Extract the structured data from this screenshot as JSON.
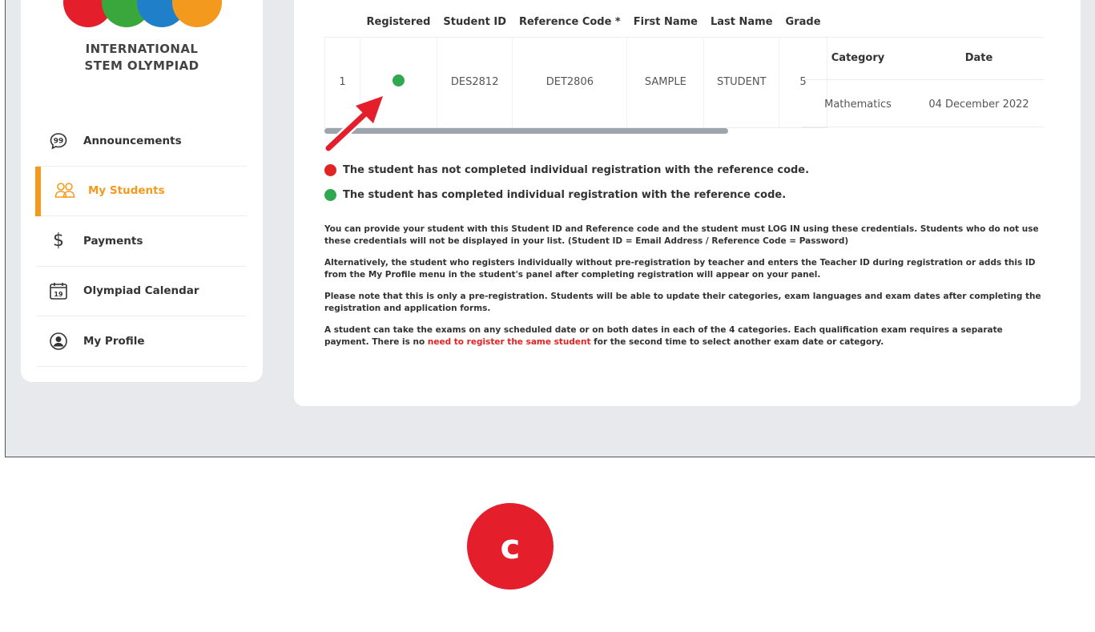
{
  "sidebar": {
    "brand_line1": "INTERNATIONAL",
    "brand_line2": "STEM OLYMPIAD",
    "logo_colors": [
      "#e41e2b",
      "#3aa73c",
      "#1f7fc8",
      "#f39a1e"
    ],
    "items": [
      {
        "label": "Announcements",
        "icon": "speech-bubble-icon",
        "active": false
      },
      {
        "label": "My Students",
        "icon": "students-icon",
        "active": true
      },
      {
        "label": "Payments",
        "icon": "dollar-icon",
        "active": false
      },
      {
        "label": "Olympiad Calendar",
        "icon": "calendar-icon",
        "active": false
      },
      {
        "label": "My Profile",
        "icon": "profile-icon",
        "active": false
      }
    ],
    "calendar_day": "19",
    "active_color": "#f39a1e"
  },
  "table": {
    "headers": [
      "Registered",
      "Student ID",
      "Reference Code *",
      "First Name",
      "Last Name",
      "Grade"
    ],
    "row": {
      "index": "1",
      "registered_status": "completed",
      "student_id": "DES2812",
      "reference_code": "DET2806",
      "first_name": "SAMPLE",
      "last_name": "STUDENT",
      "grade": "5"
    },
    "sub_headers": [
      "Category",
      "Date"
    ],
    "sub_row": {
      "category": "Mathematics",
      "date": "04 December 2022"
    }
  },
  "legend": {
    "not_completed": "The student has not completed individual registration with the reference code.",
    "completed": "The student has completed individual registration with the reference code.",
    "red_color": "#e02424",
    "green_color": "#2fa84f"
  },
  "paragraphs": {
    "p1": "You can provide your student with this Student ID and Reference code and the student must LOG IN using these credentials. Students who do not use these credentials will not be displayed in your list. (Student ID = Email Address / Reference Code = Password)",
    "p2": "Alternatively, the student who registers individually without pre-registration by teacher and enters the Teacher ID during registration or adds this ID from the My Profile menu in the student's panel after completing registration will appear on your panel.",
    "p3": "Please note that this is only a pre-registration. Students will be able to update their categories, exam languages and exam dates after completing the registration and application forms.",
    "p4_start": "A student can take the exams on any scheduled date or on both dates in each of the 4 categories. Each qualification exam requires a separate payment. There is no ",
    "p4_highlight": "need to register the same student",
    "p4_end": " for the second time to select another exam date or category."
  },
  "badge": {
    "letter": "c",
    "color": "#e41e2b"
  }
}
